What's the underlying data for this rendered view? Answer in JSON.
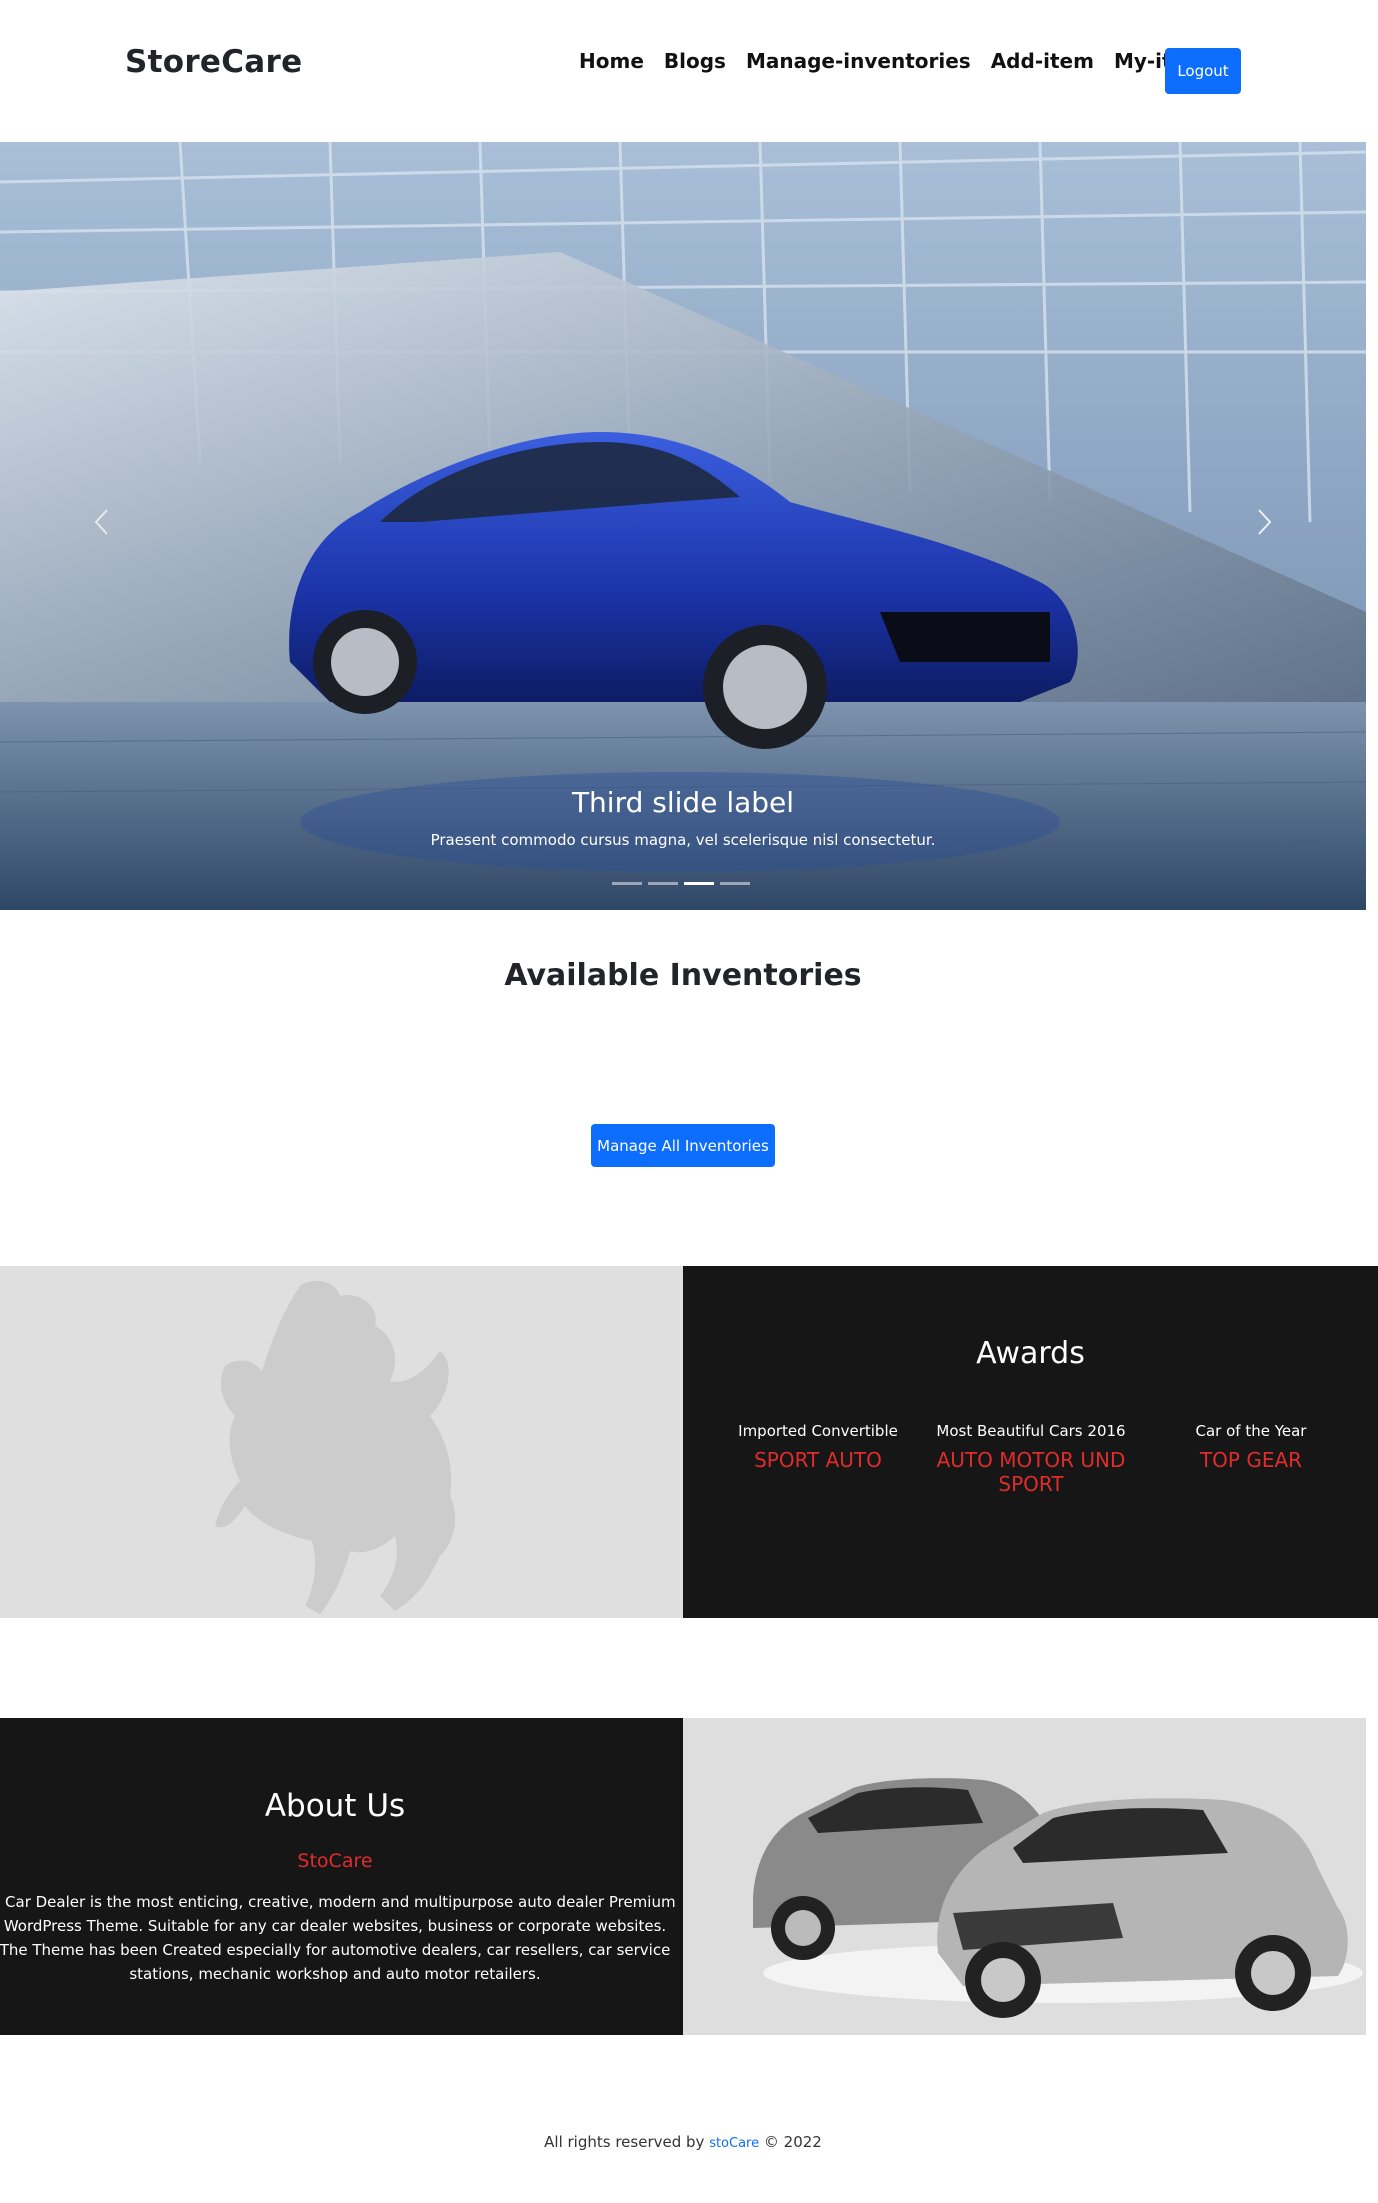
{
  "nav": {
    "brand": "StoreCare",
    "links": [
      "Home",
      "Blogs",
      "Manage-inventories",
      "Add-item",
      "My-items"
    ],
    "logout": "Logout"
  },
  "carousel": {
    "caption_title": "Third slide label",
    "caption_text": "Praesent commodo cursus magna, vel scelerisque nisl consectetur.",
    "slide_count": 4,
    "active_index": 2,
    "prev_icon": "chevron-left-icon",
    "next_icon": "chevron-right-icon"
  },
  "inventories": {
    "title": "Available Inventories",
    "button": "Manage All Inventories"
  },
  "awards": {
    "title": "Awards",
    "items": [
      {
        "label": "Imported Convertible",
        "name": "SPORT AUTO"
      },
      {
        "label": "Most Beautiful Cars 2016",
        "name": "AUTO MOTOR UND SPORT"
      },
      {
        "label": "Car of the Year",
        "name": "TOP GEAR"
      }
    ]
  },
  "about": {
    "title": "About Us",
    "subtitle": "StoCare",
    "text": "( Car Dealer is the most enticing, creative, modern and multipurpose auto dealer Premium WordPress Theme. Suitable for any car dealer websites, business or corporate websites. The Theme has been Created especially for automotive dealers, car resellers, car service stations, mechanic workshop and auto motor retailers."
  },
  "footer": {
    "prefix": "All rights reserved by",
    "link": "stoCare",
    "suffix": "© 2022"
  },
  "colors": {
    "primary": "#0d6efd",
    "accent_red": "#e02c2c",
    "dark": "#161616",
    "light_gray": "#dfdfdf"
  }
}
